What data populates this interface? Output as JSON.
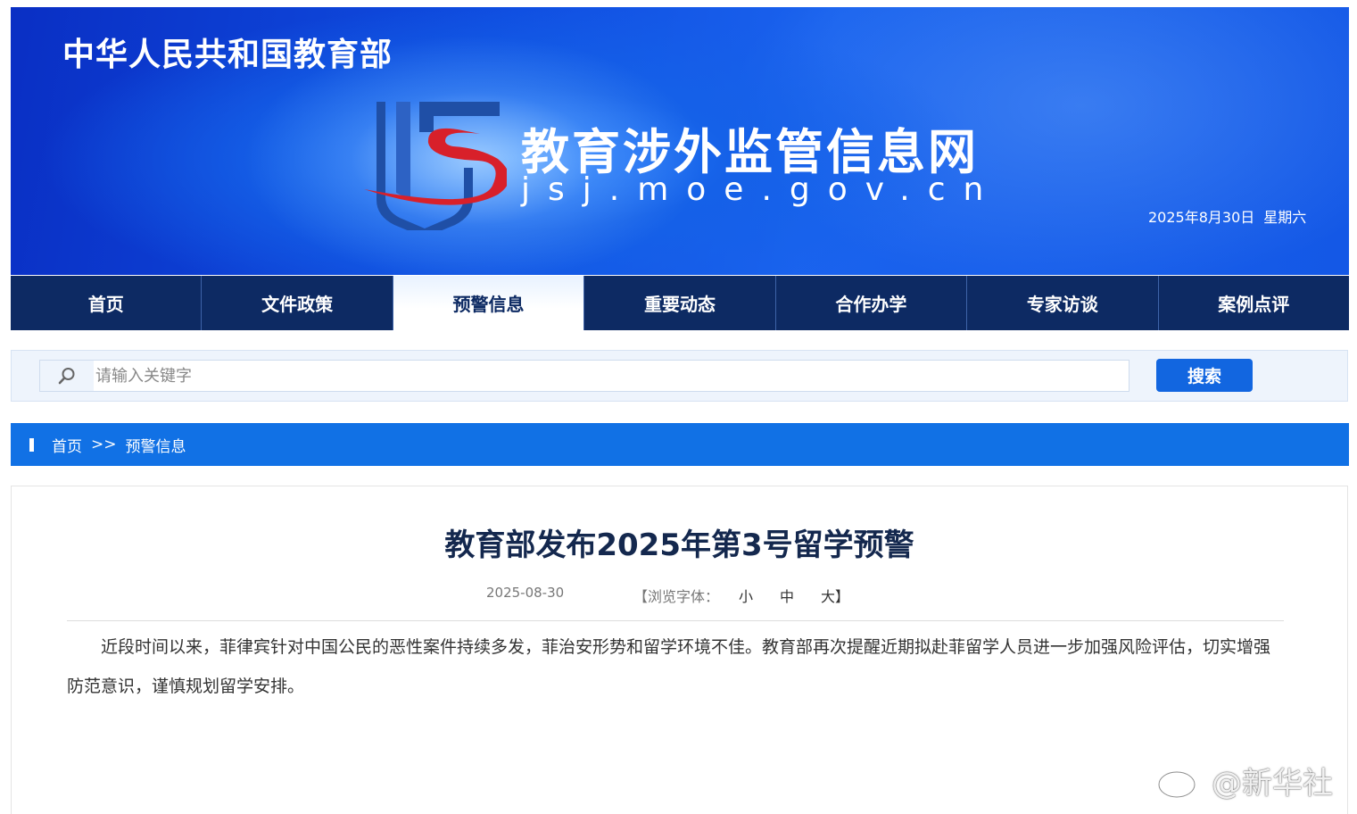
{
  "header": {
    "ministry_name": "中华人民共和国教育部",
    "site_title": "教育涉外监管信息网",
    "site_url": "jsj.moe.gov.cn",
    "date": "2025年8月30日",
    "weekday": "星期六"
  },
  "nav": {
    "items": [
      {
        "label": "首页"
      },
      {
        "label": "文件政策"
      },
      {
        "label": "预警信息"
      },
      {
        "label": "重要动态"
      },
      {
        "label": "合作办学"
      },
      {
        "label": "专家访谈"
      },
      {
        "label": "案例点评"
      }
    ],
    "active": "预警信息"
  },
  "search": {
    "placeholder": "请输入关键字",
    "value": "",
    "button_label": "搜索"
  },
  "breadcrumb": {
    "home": "首页",
    "separator": ">>",
    "current": "预警信息"
  },
  "article": {
    "title": "教育部发布2025年第3号留学预警",
    "date": "2025-08-30",
    "font_size_label": "【浏览字体：",
    "font_small": "小",
    "font_medium": "中",
    "font_large": "大】",
    "body": "近段时间以来，菲律宾针对中国公民的恶性案件持续多发，菲治安形势和留学环境不佳。教育部再次提醒近期拟赴菲留学人员进一步加强风险评估，切实增强防范意识，谨慎规划留学安排。"
  },
  "watermark": {
    "text": "@新华社"
  },
  "colors": {
    "banner_blue": "#1458e6",
    "nav_navy": "#0d2a63",
    "breadcrumb_blue": "#1171e5",
    "search_button": "#1266e0",
    "logo_red": "#d8202a",
    "logo_blue": "#1f4fa6"
  }
}
